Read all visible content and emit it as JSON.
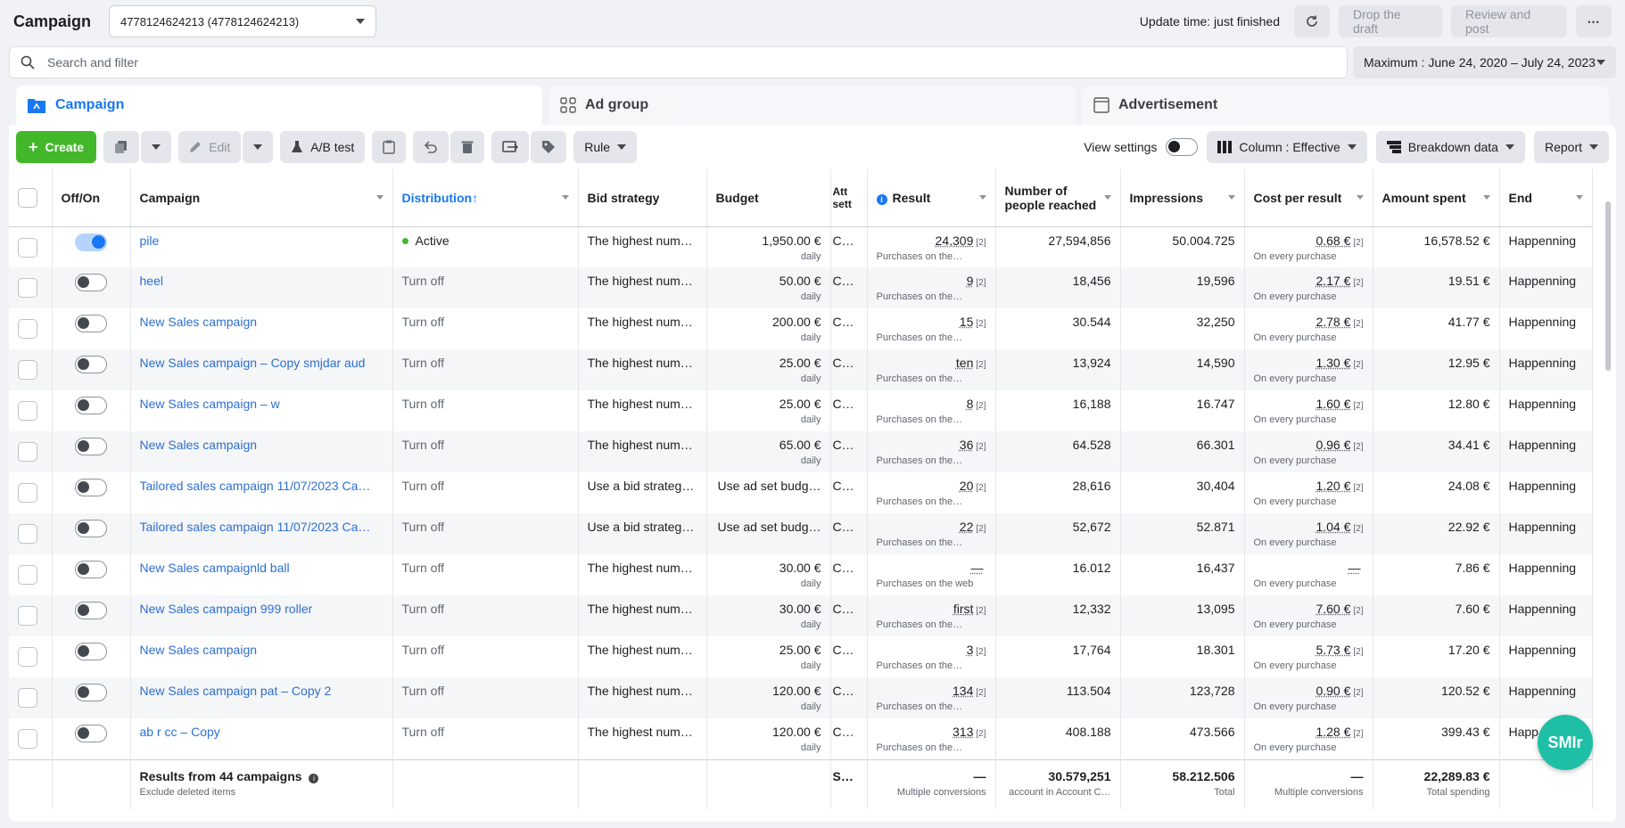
{
  "header": {
    "title": "Campaign",
    "account": "4778124624213 (4778124624213)",
    "update_time": "Update time: just finished",
    "drop_draft": "Drop the draft",
    "review_post": "Review and post"
  },
  "search": {
    "placeholder": "Search and filter",
    "date_range": "Maximum : June 24, 2020 – July 24, 2023"
  },
  "tabs": [
    "Campaign",
    "Ad group",
    "Advertisement"
  ],
  "toolbar": {
    "create": "Create",
    "edit": "Edit",
    "ab_test": "A/B test",
    "rule": "Rule",
    "view_settings": "View settings",
    "column": "Column : Effective",
    "breakdown": "Breakdown data",
    "report": "Report"
  },
  "columns": [
    "Off/On",
    "Campaign",
    "Distribution",
    "Bid strategy",
    "Budget",
    "Att sett",
    "Result",
    "Number of people reached",
    "Impressions",
    "Cost per result",
    "Amount spent",
    "End"
  ],
  "rows": [
    {
      "on": true,
      "name": "pile",
      "dist": "Active",
      "bid": "The highest num…",
      "budget": "1,950.00 €",
      "budget_sub": "daily",
      "attr": "C…",
      "result": "24,309",
      "result_ref": "[2]",
      "result_sub": "Purchases on the…",
      "reach": "27,594,856",
      "impr": "50.004.725",
      "cpr": "0.68 €",
      "cpr_ref": "[2]",
      "cpr_sub": "On every purchase",
      "spent": "16,578.52 €",
      "end": "Happenning"
    },
    {
      "on": false,
      "name": "heel",
      "dist": "Turn off",
      "bid": "The highest num…",
      "budget": "50.00 €",
      "budget_sub": "daily",
      "attr": "C…",
      "result": "9",
      "result_ref": "[2]",
      "result_sub": "Purchases on the…",
      "reach": "18,456",
      "impr": "19,596",
      "cpr": "2.17 €",
      "cpr_ref": "[2]",
      "cpr_sub": "On every purchase",
      "spent": "19.51 €",
      "end": "Happenning"
    },
    {
      "on": false,
      "name": "New Sales campaign",
      "dist": "Turn off",
      "bid": "The highest num…",
      "budget": "200.00 €",
      "budget_sub": "daily",
      "attr": "C…",
      "result": "15",
      "result_ref": "[2]",
      "result_sub": "Purchases on the…",
      "reach": "30.544",
      "impr": "32,250",
      "cpr": "2.78 €",
      "cpr_ref": "[2]",
      "cpr_sub": "On every purchase",
      "spent": "41.77 €",
      "end": "Happenning"
    },
    {
      "on": false,
      "name": "New Sales campaign – Copy smjdar aud",
      "dist": "Turn off",
      "bid": "The highest num…",
      "budget": "25.00 €",
      "budget_sub": "daily",
      "attr": "C…",
      "result": "ten",
      "result_ref": "[2]",
      "result_sub": "Purchases on the…",
      "reach": "13,924",
      "impr": "14,590",
      "cpr": "1.30 €",
      "cpr_ref": "[2]",
      "cpr_sub": "On every purchase",
      "spent": "12.95 €",
      "end": "Happenning"
    },
    {
      "on": false,
      "name": "New Sales campaign – w",
      "dist": "Turn off",
      "bid": "The highest num…",
      "budget": "25.00 €",
      "budget_sub": "daily",
      "attr": "C…",
      "result": "8",
      "result_ref": "[2]",
      "result_sub": "Purchases on the…",
      "reach": "16,188",
      "impr": "16.747",
      "cpr": "1.60 €",
      "cpr_ref": "[2]",
      "cpr_sub": "On every purchase",
      "spent": "12.80 €",
      "end": "Happenning"
    },
    {
      "on": false,
      "name": "New Sales campaign",
      "dist": "Turn off",
      "bid": "The highest num…",
      "budget": "65.00 €",
      "budget_sub": "daily",
      "attr": "C…",
      "result": "36",
      "result_ref": "[2]",
      "result_sub": "Purchases on the…",
      "reach": "64.528",
      "impr": "66.301",
      "cpr": "0.96 €",
      "cpr_ref": "[2]",
      "cpr_sub": "On every purchase",
      "spent": "34.41 €",
      "end": "Happenning"
    },
    {
      "on": false,
      "name": "Tailored sales campaign 11/07/2023 Ca…",
      "dist": "Turn off",
      "bid": "Use a bid strateg…",
      "budget": "Use ad set budg…",
      "budget_sub": "",
      "attr": "C…",
      "result": "20",
      "result_ref": "[2]",
      "result_sub": "Purchases on the…",
      "reach": "28,616",
      "impr": "30,404",
      "cpr": "1.20 €",
      "cpr_ref": "[2]",
      "cpr_sub": "On every purchase",
      "spent": "24.08 €",
      "end": "Happenning"
    },
    {
      "on": false,
      "name": "Tailored sales campaign 11/07/2023 Ca…",
      "dist": "Turn off",
      "bid": "Use a bid strateg…",
      "budget": "Use ad set budg…",
      "budget_sub": "",
      "attr": "C…",
      "result": "22",
      "result_ref": "[2]",
      "result_sub": "Purchases on the…",
      "reach": "52,672",
      "impr": "52.871",
      "cpr": "1.04 €",
      "cpr_ref": "[2]",
      "cpr_sub": "On every purchase",
      "spent": "22.92 €",
      "end": "Happenning"
    },
    {
      "on": false,
      "name": "New Sales campaignld ball",
      "dist": "Turn off",
      "bid": "The highest num…",
      "budget": "30.00 €",
      "budget_sub": "daily",
      "attr": "C…",
      "result": "—",
      "result_ref": "",
      "result_sub": "Purchases on the web",
      "reach": "16.012",
      "impr": "16,437",
      "cpr": "—",
      "cpr_ref": "",
      "cpr_sub": "On every purchase",
      "spent": "7.86 €",
      "end": "Happenning"
    },
    {
      "on": false,
      "name": "New Sales campaign 999 roller",
      "dist": "Turn off",
      "bid": "The highest num…",
      "budget": "30.00 €",
      "budget_sub": "daily",
      "attr": "C…",
      "result": "first",
      "result_ref": "[2]",
      "result_sub": "Purchases on the…",
      "reach": "12,332",
      "impr": "13,095",
      "cpr": "7.60 €",
      "cpr_ref": "[2]",
      "cpr_sub": "On every purchase",
      "spent": "7.60 €",
      "end": "Happenning"
    },
    {
      "on": false,
      "name": "New Sales campaign",
      "dist": "Turn off",
      "bid": "The highest num…",
      "budget": "25.00 €",
      "budget_sub": "daily",
      "attr": "C…",
      "result": "3",
      "result_ref": "[2]",
      "result_sub": "Purchases on the…",
      "reach": "17,764",
      "impr": "18.301",
      "cpr": "5.73 €",
      "cpr_ref": "[2]",
      "cpr_sub": "On every purchase",
      "spent": "17.20 €",
      "end": "Happenning"
    },
    {
      "on": false,
      "name": "New Sales campaign pat – Copy 2",
      "dist": "Turn off",
      "bid": "The highest num…",
      "budget": "120.00 €",
      "budget_sub": "daily",
      "attr": "C…",
      "result": "134",
      "result_ref": "[2]",
      "result_sub": "Purchases on the…",
      "reach": "113.504",
      "impr": "123,728",
      "cpr": "0.90 €",
      "cpr_ref": "[2]",
      "cpr_sub": "On every purchase",
      "spent": "120.52 €",
      "end": "Happenning"
    },
    {
      "on": false,
      "name": "ab r cc – Copy",
      "dist": "Turn off",
      "bid": "The highest num…",
      "budget": "120.00 €",
      "budget_sub": "daily",
      "attr": "C…",
      "result": "313",
      "result_ref": "[2]",
      "result_sub": "Purchases on the…",
      "reach": "408.188",
      "impr": "473.566",
      "cpr": "1.28 €",
      "cpr_ref": "[2]",
      "cpr_sub": "On every purchase",
      "spent": "399.43 €",
      "end": "Happ"
    }
  ],
  "footer": {
    "title": "Results from 44 campaigns",
    "subtitle": "Exclude deleted items",
    "attr": "S…",
    "result": "—",
    "result_sub": "Multiple conversions",
    "reach": "30.579,251",
    "reach_sub": "account in Account C…",
    "impr": "58.212.506",
    "impr_sub": "Total",
    "cpr": "—",
    "cpr_sub": "Multiple conversions",
    "spent": "22,289.83 €",
    "spent_sub": "Total spending"
  },
  "badge": "SMIr",
  "colors": {
    "accent": "#1877f2",
    "create": "#42b72a",
    "link": "#2d6fd1",
    "badge": "#1fbfa6"
  }
}
